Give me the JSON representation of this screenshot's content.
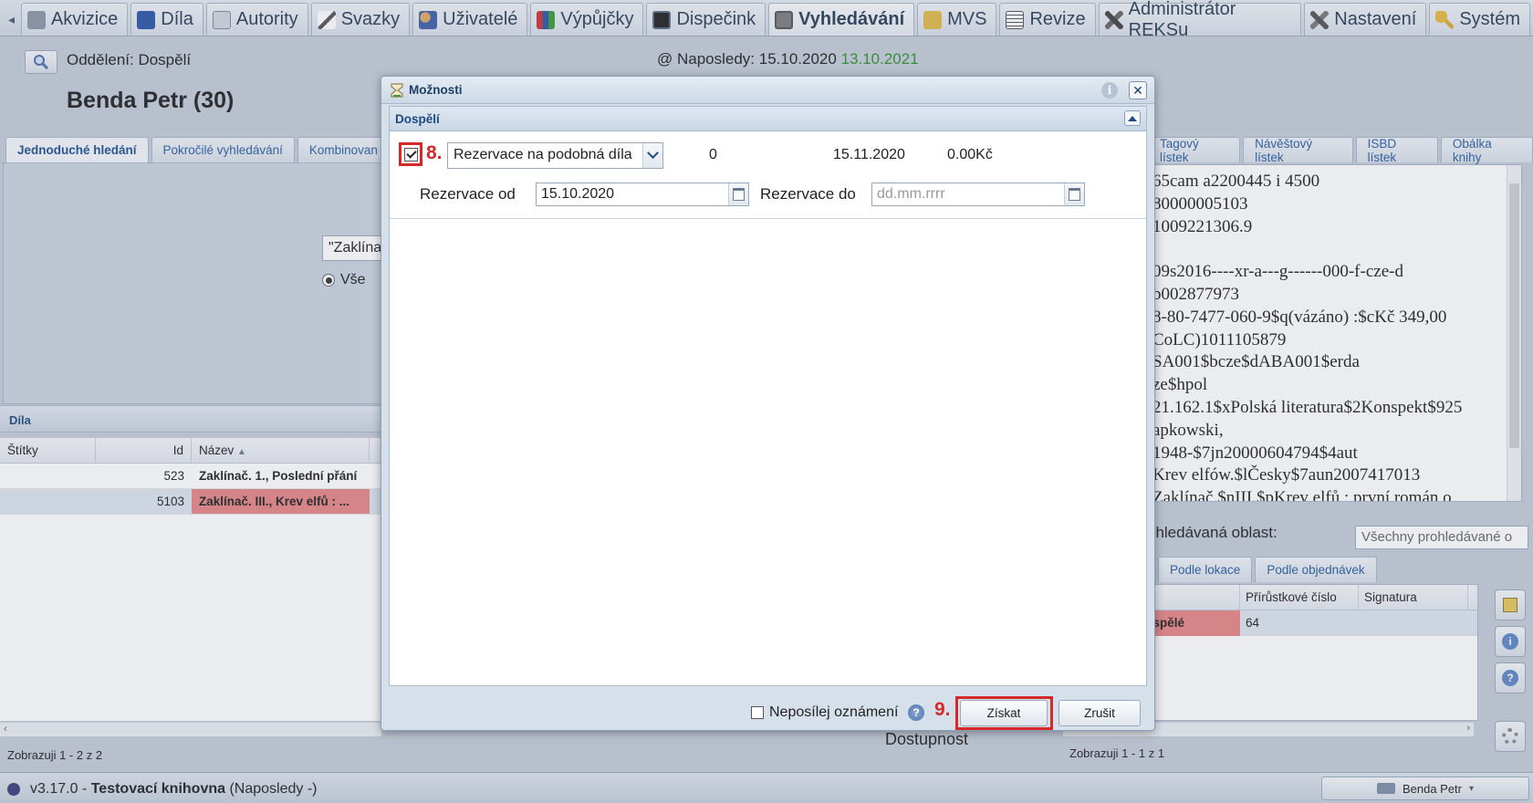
{
  "menubar": {
    "items": [
      {
        "label": "Akvizice",
        "icon": "cart-icon"
      },
      {
        "label": "Díla",
        "icon": "book-icon"
      },
      {
        "label": "Autority",
        "icon": "id-card-icon"
      },
      {
        "label": "Svazky",
        "icon": "pen-icon"
      },
      {
        "label": "Uživatelé",
        "icon": "users-icon"
      },
      {
        "label": "Výpůjčky",
        "icon": "books-icon"
      },
      {
        "label": "Dispečink",
        "icon": "monitor-icon"
      },
      {
        "label": "Vyhledávání",
        "icon": "catalog-icon",
        "active": true
      },
      {
        "label": "MVS",
        "icon": "box-icon"
      },
      {
        "label": "Revize",
        "icon": "checklist-icon"
      },
      {
        "label": "Administrátor REKSu",
        "icon": "tools-icon"
      },
      {
        "label": "Nastavení",
        "icon": "wrench-icon"
      },
      {
        "label": "Systém",
        "icon": "key-icon"
      }
    ]
  },
  "header": {
    "department": "Oddělení: Dospělí",
    "last_label": "@ Naposledy: 15.10.2020",
    "last_green": "13.10.2021",
    "patron": "Benda Petr (30)"
  },
  "left_tabs": [
    "Jednoduché hledání",
    "Pokročilé vyhledávání",
    "Kombinovan"
  ],
  "search": {
    "query": "\"Zaklínač",
    "radio_all": "Vše"
  },
  "works": {
    "title": "Díla",
    "columns": [
      "Štítky",
      "Id",
      "Název"
    ],
    "rows": [
      {
        "tags": "",
        "id": "523",
        "name": "Zaklínač. 1., Poslední přání"
      },
      {
        "tags": "",
        "id": "5103",
        "name": "Zaklínač. III., Krev elfů : ..."
      }
    ],
    "shown": "Zobrazuji 1 - 2 z 2"
  },
  "right": {
    "tabs": [
      "Tagový lístek",
      "Návěštový lístek",
      "ISBD lístek",
      "Obálka knihy"
    ],
    "marc_lines": [
      "65cam a2200445 i 4500",
      "80000005103",
      "1009221306.9",
      "",
      "09s2016----xr-a---g------000-f-cze-d",
      "b002877973",
      "8-80-7477-060-9$q(vázáno) :$cKč 349,00",
      "CoLC)1011105879",
      "SA001$bcze$dABA001$erda",
      "ze$hpol",
      "21.162.1$xPolská literatura$2Konspekt$925",
      "apkowski,",
      "1948-$7jn20000604794$4aut",
      "Krev elfów.$lČesky$7aun2007417013",
      "Zaklínač.$nIII.$pKrev elfů : první román o"
    ],
    "area_label": "Prohledávaná oblast:",
    "area_value": "Všechny prohledávané o",
    "subtabs": [
      "",
      "Podle lokace",
      "Podle objednávek"
    ],
    "items_columns": [
      "",
      "Přírůstkové číslo",
      "Signatura"
    ],
    "items_row": {
      "location": "dospělé",
      "accession": "64",
      "signature": ""
    },
    "availability": "Dostupnost",
    "shown": "Zobrazuji 1 - 1 z 1"
  },
  "status": {
    "version": "v3.17.0 - ",
    "library": "Testovací knihovna",
    "suffix": " (Naposledy -)",
    "user": "Benda Petr"
  },
  "dialog": {
    "title": "Možnosti",
    "section": "Dospělí",
    "step8": "8.",
    "step9": "9.",
    "option_select": "Rezervace na podobná díla",
    "option_count": "0",
    "option_date": "15.11.2020",
    "option_price": "0.00Kč",
    "from_label": "Rezervace od",
    "from_value": "15.10.2020",
    "to_label": "Rezervace do",
    "to_placeholder": "dd.mm.rrrr",
    "no_notify": "Neposílej oznámení",
    "get_button": "Získat",
    "cancel_button": "Zrušit"
  }
}
